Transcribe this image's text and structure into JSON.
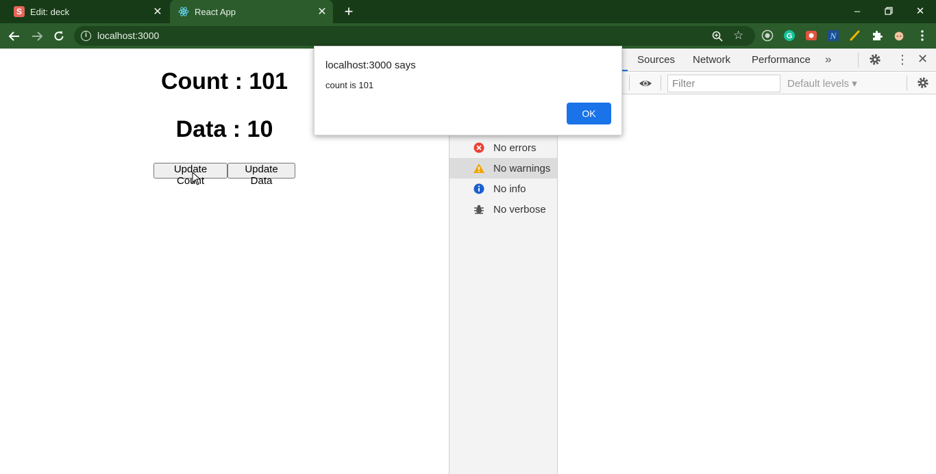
{
  "browser": {
    "tabs": [
      {
        "title": "Edit: deck",
        "favicon_letter": "S"
      },
      {
        "title": "React App"
      }
    ],
    "url": "localhost:3000"
  },
  "page": {
    "count_heading": "Count : 101",
    "data_heading": "Data : 10",
    "update_count_label": "Update Count",
    "update_data_label": "Update Data"
  },
  "devtools": {
    "tabs": [
      "Sources",
      "Network",
      "Performance"
    ],
    "filter_placeholder": "Filter",
    "levels_label": "Default levels ▾",
    "sidebar": [
      {
        "label": "No errors",
        "icon": "error-icon"
      },
      {
        "label": "No warnings",
        "icon": "warning-icon"
      },
      {
        "label": "No info",
        "icon": "info-icon"
      },
      {
        "label": "No verbose",
        "icon": "bug-icon"
      }
    ]
  },
  "dialog": {
    "title": "localhost:3000 says",
    "message": "count is 101",
    "ok_label": "OK"
  },
  "colors": {
    "tabstrip": "#173b17",
    "toolbar": "#2c5c2c",
    "accent": "#1a73e8"
  }
}
